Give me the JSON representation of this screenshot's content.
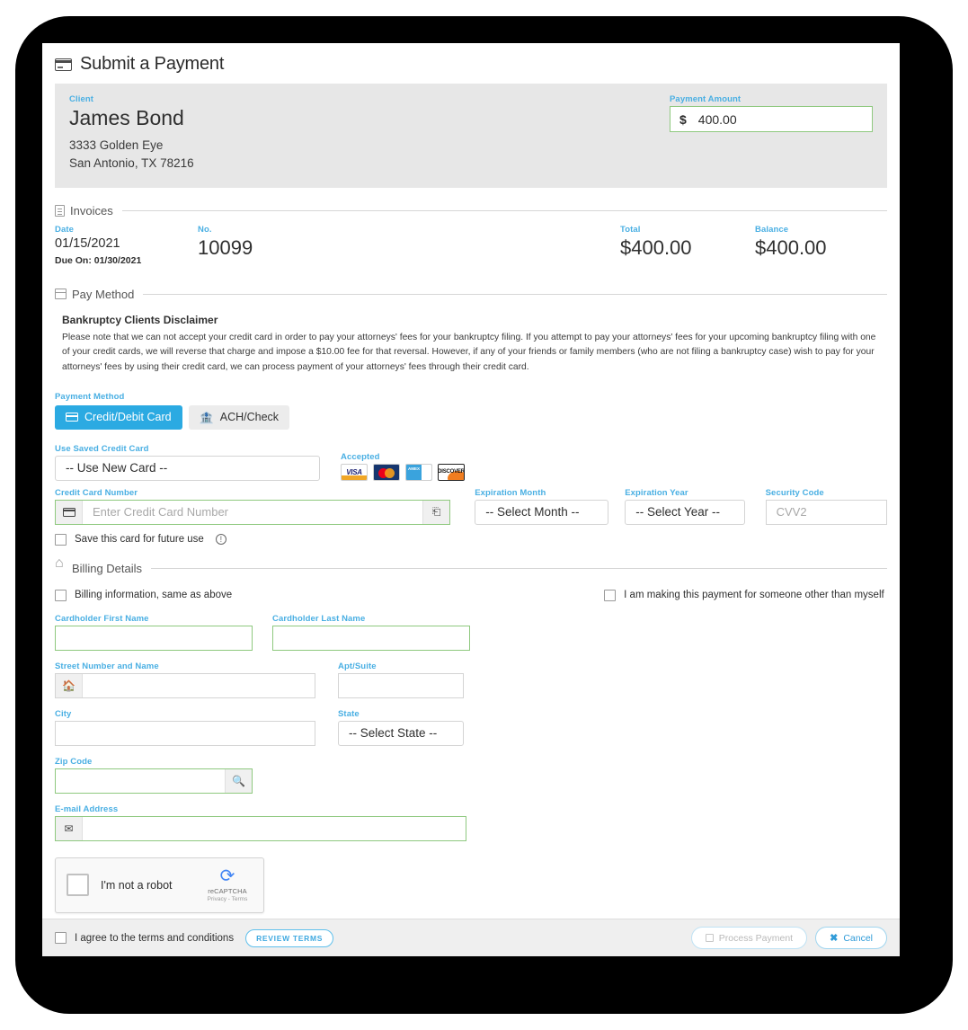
{
  "page": {
    "title": "Submit a Payment",
    "title_icon": "credit-card-icon"
  },
  "client": {
    "label": "Client",
    "name": "James Bond",
    "address_line1": "3333 Golden Eye",
    "address_line2": "San Antonio, TX 78216"
  },
  "payment_amount": {
    "label": "Payment Amount",
    "currency": "$",
    "value": "400.00"
  },
  "invoices": {
    "section_title": "Invoices",
    "columns": {
      "date": "Date",
      "number": "No.",
      "total": "Total",
      "balance": "Balance"
    },
    "rows": [
      {
        "date": "01/15/2021",
        "due": "Due On: 01/30/2021",
        "number": "10099",
        "total": "$400.00",
        "balance": "$400.00"
      }
    ]
  },
  "pay_method": {
    "section_title": "Pay Method",
    "disclaimer_title": "Bankruptcy Clients Disclaimer",
    "disclaimer_body": "Please note that we can not accept your credit card in order to pay your attorneys' fees for your bankruptcy filing. If you attempt to pay your attorneys' fees for your upcoming bankruptcy filing with one of your credit cards, we will reverse that charge and impose a $10.00 fee for that reversal. However, if any of your friends or family members (who are not filing a bankruptcy case) wish to pay for your attorneys' fees by using their credit card, we can process payment of your attorneys' fees through their credit card.",
    "method_label": "Payment Method",
    "tabs": [
      {
        "label": "Credit/Debit Card",
        "icon": "credit-card-icon",
        "active": true
      },
      {
        "label": "ACH/Check",
        "icon": "bank-icon",
        "active": false
      }
    ],
    "saved_card_label": "Use Saved Credit Card",
    "saved_card_value": "-- Use New Card --",
    "accepted_label": "Accepted",
    "accepted_cards": [
      "VISA",
      "MasterCard",
      "American Express",
      "Discover"
    ],
    "card_number_label": "Credit Card Number",
    "card_number_placeholder": "Enter Credit Card Number",
    "expiration_month_label": "Expiration Month",
    "expiration_month_value": "-- Select Month --",
    "expiration_year_label": "Expiration Year",
    "expiration_year_value": "-- Select Year --",
    "security_code_label": "Security Code",
    "security_code_placeholder": "CVV2",
    "save_card_label": "Save this card for future use"
  },
  "billing": {
    "section_title": "Billing Details",
    "same_as_above_label": "Billing information, same as above",
    "other_person_label": "I am making this payment for someone other than myself",
    "first_name_label": "Cardholder First Name",
    "first_name_value": "",
    "last_name_label": "Cardholder Last Name",
    "last_name_value": "",
    "street_label": "Street Number and Name",
    "street_value": "",
    "apt_label": "Apt/Suite",
    "apt_value": "",
    "city_label": "City",
    "city_value": "",
    "state_label": "State",
    "state_value": "-- Select State --",
    "zip_label": "Zip Code",
    "zip_value": "",
    "email_label": "E-mail Address",
    "email_value": ""
  },
  "recaptcha": {
    "checkbox_label": "I'm not a robot",
    "brand": "reCAPTCHA",
    "links": "Privacy - Terms"
  },
  "footer": {
    "terms_label": "I agree to the terms and conditions",
    "review_terms_label": "REVIEW TERMS",
    "process_label": "Process Payment",
    "cancel_label": "Cancel"
  },
  "colors": {
    "accent_blue": "#49afe3",
    "tab_blue": "#2baae2",
    "valid_green": "#8fc97f",
    "panel_grey": "#e7e7e7"
  }
}
